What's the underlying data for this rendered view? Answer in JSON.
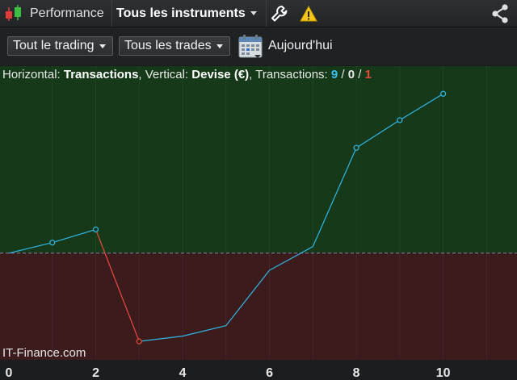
{
  "toolbar": {
    "app_title": "Performance",
    "instrument_select": "Tous les instruments",
    "icons": [
      "candlestick-icon",
      "wrench-icon",
      "warning-icon",
      "share-icon"
    ]
  },
  "filters": {
    "trading_select": "Tout le trading",
    "trades_select": "Tous les trades",
    "date_label": "Aujourd'hui"
  },
  "info": {
    "horizontal_prefix": "Horizontal: ",
    "horizontal_value": "Transactions",
    "vertical_prefix": ", Vertical: ",
    "vertical_value": "Devise (€)",
    "transactions_prefix": ", Transactions: ",
    "count_win": "9",
    "sep1": " / ",
    "count_even": "0",
    "sep2": " / ",
    "count_loss": "1"
  },
  "watermark": "IT-Finance.com",
  "colors": {
    "profit_zone": "#16391a",
    "loss_zone": "#3c1b1d",
    "line_up": "#2fb8e8",
    "line_down": "#e84a3a"
  },
  "chart_data": {
    "type": "line",
    "x": [
      0,
      1,
      2,
      3,
      4,
      5,
      6,
      7,
      8,
      9,
      10
    ],
    "y": [
      0.0,
      0.8,
      1.8,
      -6.7,
      -6.3,
      -5.5,
      -1.3,
      0.5,
      8.0,
      10.1,
      12.1
    ],
    "marked_points": [
      1,
      2,
      3,
      8,
      9,
      10
    ],
    "xticks": [
      "0",
      "2",
      "4",
      "6",
      "8",
      "10"
    ],
    "xlim": [
      0,
      11.7
    ],
    "ylim": [
      -8.1,
      14.2
    ],
    "baseline": 0
  }
}
